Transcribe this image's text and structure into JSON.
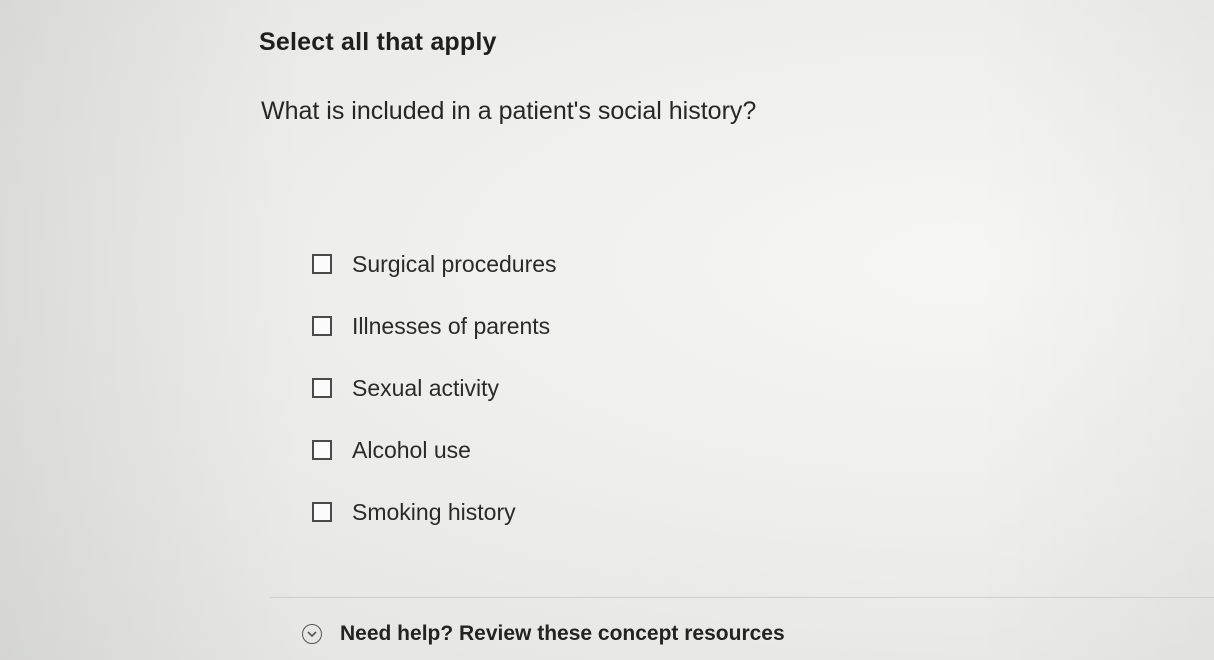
{
  "header": {
    "instruction": "Select all that apply"
  },
  "question": {
    "text": "What is included in a patient's social history?"
  },
  "options": [
    {
      "label": "Surgical procedures",
      "checked": false
    },
    {
      "label": "Illnesses of parents",
      "checked": false
    },
    {
      "label": "Sexual activity",
      "checked": false
    },
    {
      "label": "Alcohol use",
      "checked": false
    },
    {
      "label": "Smoking history",
      "checked": false
    }
  ],
  "help": {
    "label": "Need help? Review these concept resources",
    "icon": "chevron-down-circle-icon"
  }
}
